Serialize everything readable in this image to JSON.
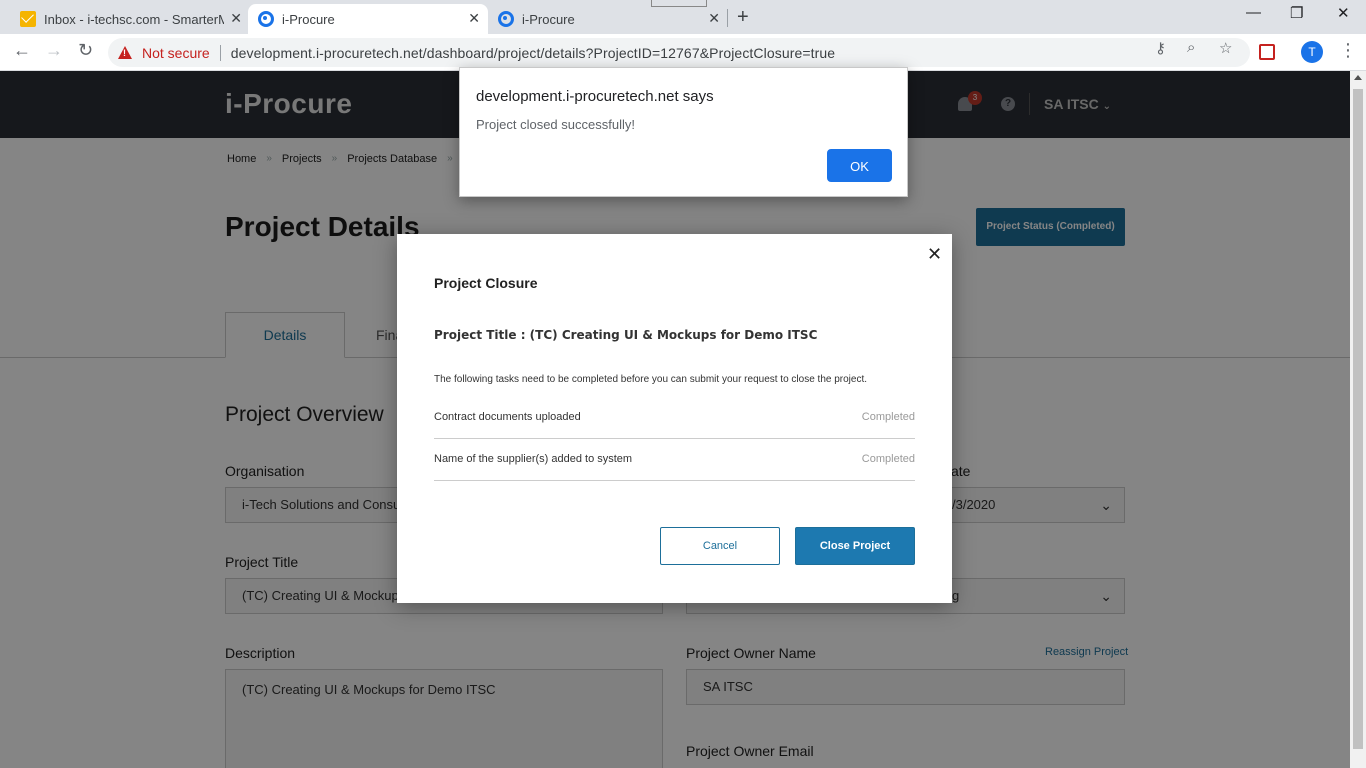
{
  "browser": {
    "tabs": [
      {
        "title": "Inbox - i-techsc.com - SmarterMail",
        "icon": "mail-icon"
      },
      {
        "title": "i-Procure",
        "icon": "iprocure-favicon"
      },
      {
        "title": "i-Procure",
        "icon": "iprocure-favicon"
      }
    ],
    "security_label": "Not secure",
    "url": "development.i-procuretech.net/dashboard/project/details?ProjectID=12767&ProjectClosure=true",
    "profile_initial": "T"
  },
  "app": {
    "logo": "i-Procure",
    "notification_count": "3",
    "user": "SA ITSC",
    "breadcrumbs": [
      "Home",
      "Projects",
      "Projects Database"
    ],
    "page_title": "Project Details",
    "status_button": "Project Status (Completed)",
    "tabs": [
      "Details",
      "Fina"
    ],
    "section_title": "Project Overview",
    "fields": {
      "organisation_label": "Organisation",
      "organisation_value": "i-Tech Solutions and Consul",
      "date_label": "ate",
      "date_value": "/3/2020",
      "project_title_label": "Project Title",
      "project_title_value": "(TC) Creating UI & Mockups",
      "right_select_value": "g",
      "description_label": "Description",
      "description_value": "(TC) Creating UI & Mockups for Demo ITSC",
      "owner_name_label": "Project Owner Name",
      "owner_name_value": "SA ITSC",
      "reassign_link": "Reassign Project",
      "owner_email_label": "Project Owner Email"
    }
  },
  "modal": {
    "title": "Project Closure",
    "project_title_line": "Project Title : (TC) Creating UI & Mockups for Demo ITSC",
    "intro": "The following tasks need to be completed before you can submit your request to close the project.",
    "tasks": [
      {
        "name": "Contract documents uploaded",
        "status": "Completed"
      },
      {
        "name": "Name of the supplier(s) added to system",
        "status": "Completed"
      }
    ],
    "cancel_label": "Cancel",
    "close_label": "Close Project"
  },
  "alert": {
    "title": "development.i-procuretech.net says",
    "message": "Project closed successfully!",
    "ok_label": "OK"
  }
}
